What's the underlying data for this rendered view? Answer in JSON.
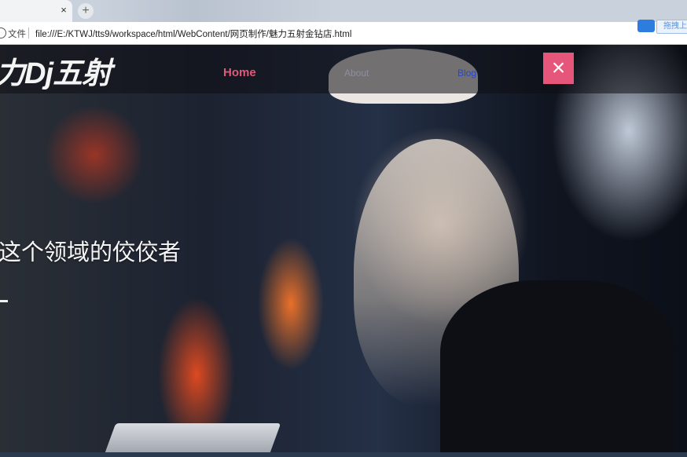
{
  "browser": {
    "tab_close": "×",
    "new_tab": "+",
    "scheme_label": "文件",
    "url": "file:///E:/KTWJ/tts9/workspace/html/WebContent/网页制作/魅力五射金钻店.html",
    "extension_label": "拖拽上"
  },
  "site": {
    "logo": "力Dj五射",
    "nav": {
      "home": "Home",
      "about": "About",
      "third": "Blog"
    },
    "close": "×",
    "tagline": "这个领域的佼佼者"
  },
  "colors": {
    "accent": "#e6567a",
    "nav_active": "#e05a78"
  }
}
